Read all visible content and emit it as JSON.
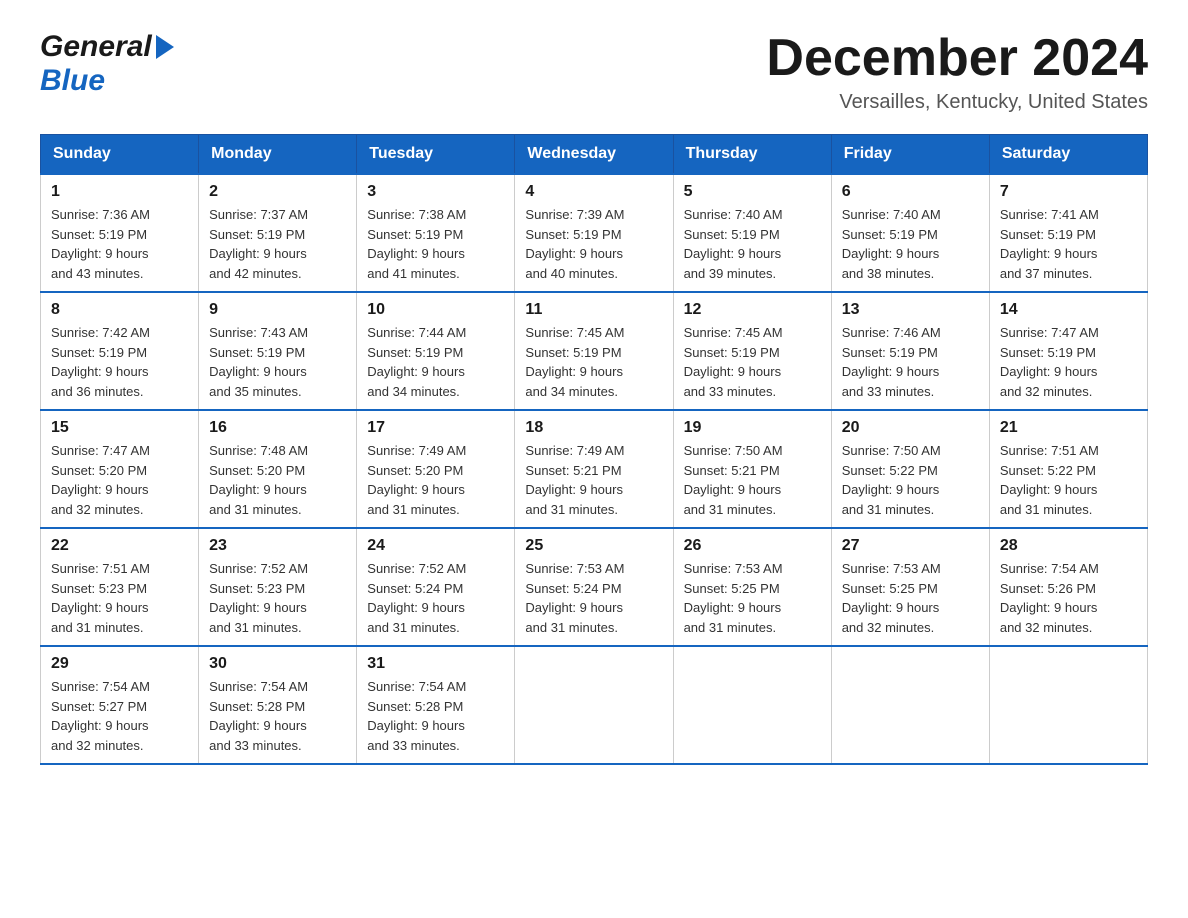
{
  "header": {
    "logo_general": "General",
    "logo_blue": "Blue",
    "month_title": "December 2024",
    "location": "Versailles, Kentucky, United States"
  },
  "weekdays": [
    "Sunday",
    "Monday",
    "Tuesday",
    "Wednesday",
    "Thursday",
    "Friday",
    "Saturday"
  ],
  "weeks": [
    [
      {
        "day": "1",
        "sunrise": "7:36 AM",
        "sunset": "5:19 PM",
        "daylight": "9 hours and 43 minutes."
      },
      {
        "day": "2",
        "sunrise": "7:37 AM",
        "sunset": "5:19 PM",
        "daylight": "9 hours and 42 minutes."
      },
      {
        "day": "3",
        "sunrise": "7:38 AM",
        "sunset": "5:19 PM",
        "daylight": "9 hours and 41 minutes."
      },
      {
        "day": "4",
        "sunrise": "7:39 AM",
        "sunset": "5:19 PM",
        "daylight": "9 hours and 40 minutes."
      },
      {
        "day": "5",
        "sunrise": "7:40 AM",
        "sunset": "5:19 PM",
        "daylight": "9 hours and 39 minutes."
      },
      {
        "day": "6",
        "sunrise": "7:40 AM",
        "sunset": "5:19 PM",
        "daylight": "9 hours and 38 minutes."
      },
      {
        "day": "7",
        "sunrise": "7:41 AM",
        "sunset": "5:19 PM",
        "daylight": "9 hours and 37 minutes."
      }
    ],
    [
      {
        "day": "8",
        "sunrise": "7:42 AM",
        "sunset": "5:19 PM",
        "daylight": "9 hours and 36 minutes."
      },
      {
        "day": "9",
        "sunrise": "7:43 AM",
        "sunset": "5:19 PM",
        "daylight": "9 hours and 35 minutes."
      },
      {
        "day": "10",
        "sunrise": "7:44 AM",
        "sunset": "5:19 PM",
        "daylight": "9 hours and 34 minutes."
      },
      {
        "day": "11",
        "sunrise": "7:45 AM",
        "sunset": "5:19 PM",
        "daylight": "9 hours and 34 minutes."
      },
      {
        "day": "12",
        "sunrise": "7:45 AM",
        "sunset": "5:19 PM",
        "daylight": "9 hours and 33 minutes."
      },
      {
        "day": "13",
        "sunrise": "7:46 AM",
        "sunset": "5:19 PM",
        "daylight": "9 hours and 33 minutes."
      },
      {
        "day": "14",
        "sunrise": "7:47 AM",
        "sunset": "5:19 PM",
        "daylight": "9 hours and 32 minutes."
      }
    ],
    [
      {
        "day": "15",
        "sunrise": "7:47 AM",
        "sunset": "5:20 PM",
        "daylight": "9 hours and 32 minutes."
      },
      {
        "day": "16",
        "sunrise": "7:48 AM",
        "sunset": "5:20 PM",
        "daylight": "9 hours and 31 minutes."
      },
      {
        "day": "17",
        "sunrise": "7:49 AM",
        "sunset": "5:20 PM",
        "daylight": "9 hours and 31 minutes."
      },
      {
        "day": "18",
        "sunrise": "7:49 AM",
        "sunset": "5:21 PM",
        "daylight": "9 hours and 31 minutes."
      },
      {
        "day": "19",
        "sunrise": "7:50 AM",
        "sunset": "5:21 PM",
        "daylight": "9 hours and 31 minutes."
      },
      {
        "day": "20",
        "sunrise": "7:50 AM",
        "sunset": "5:22 PM",
        "daylight": "9 hours and 31 minutes."
      },
      {
        "day": "21",
        "sunrise": "7:51 AM",
        "sunset": "5:22 PM",
        "daylight": "9 hours and 31 minutes."
      }
    ],
    [
      {
        "day": "22",
        "sunrise": "7:51 AM",
        "sunset": "5:23 PM",
        "daylight": "9 hours and 31 minutes."
      },
      {
        "day": "23",
        "sunrise": "7:52 AM",
        "sunset": "5:23 PM",
        "daylight": "9 hours and 31 minutes."
      },
      {
        "day": "24",
        "sunrise": "7:52 AM",
        "sunset": "5:24 PM",
        "daylight": "9 hours and 31 minutes."
      },
      {
        "day": "25",
        "sunrise": "7:53 AM",
        "sunset": "5:24 PM",
        "daylight": "9 hours and 31 minutes."
      },
      {
        "day": "26",
        "sunrise": "7:53 AM",
        "sunset": "5:25 PM",
        "daylight": "9 hours and 31 minutes."
      },
      {
        "day": "27",
        "sunrise": "7:53 AM",
        "sunset": "5:25 PM",
        "daylight": "9 hours and 32 minutes."
      },
      {
        "day": "28",
        "sunrise": "7:54 AM",
        "sunset": "5:26 PM",
        "daylight": "9 hours and 32 minutes."
      }
    ],
    [
      {
        "day": "29",
        "sunrise": "7:54 AM",
        "sunset": "5:27 PM",
        "daylight": "9 hours and 32 minutes."
      },
      {
        "day": "30",
        "sunrise": "7:54 AM",
        "sunset": "5:28 PM",
        "daylight": "9 hours and 33 minutes."
      },
      {
        "day": "31",
        "sunrise": "7:54 AM",
        "sunset": "5:28 PM",
        "daylight": "9 hours and 33 minutes."
      },
      null,
      null,
      null,
      null
    ]
  ],
  "labels": {
    "sunrise": "Sunrise:",
    "sunset": "Sunset:",
    "daylight": "Daylight:"
  }
}
